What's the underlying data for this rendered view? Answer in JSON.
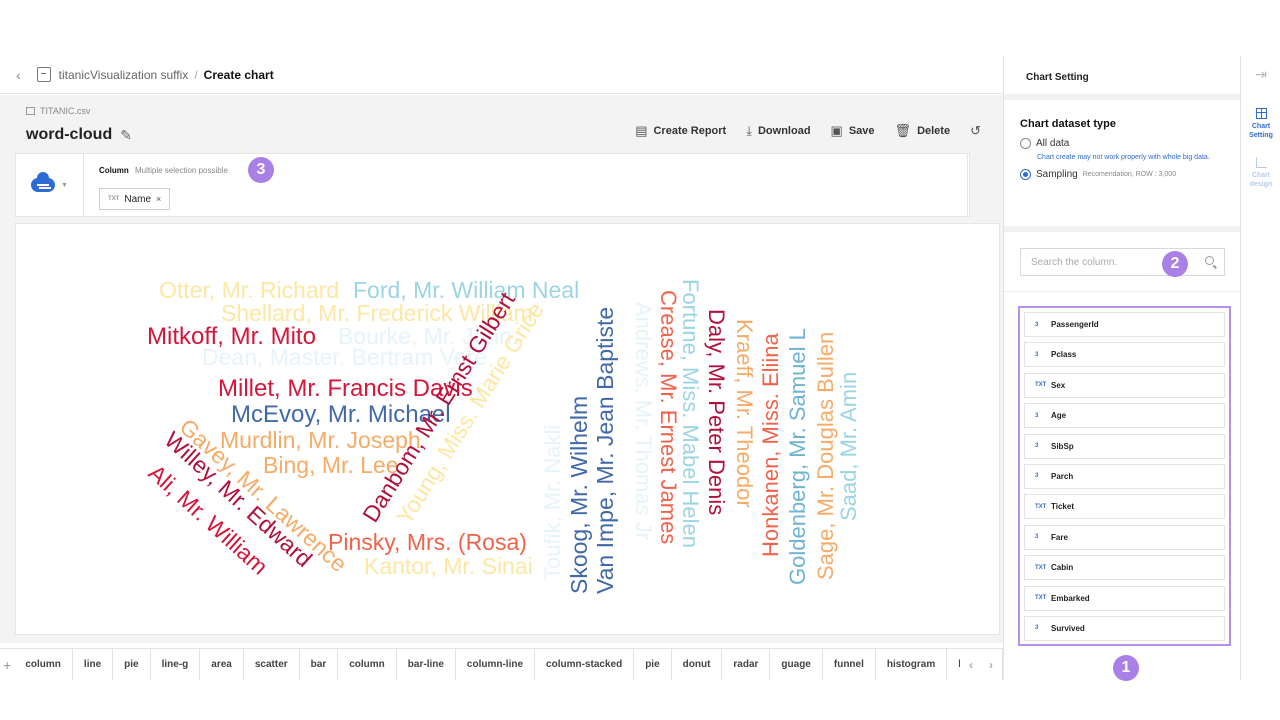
{
  "header": {
    "back_icon": "chevron-left-icon",
    "workbook_icon": "workbook-icon",
    "workbook": "titanicVisualization suffix",
    "separator": "/",
    "page": "Create chart"
  },
  "chart": {
    "dataset_file": "TITANIC.csv",
    "name": "word-cloud"
  },
  "toolbar": {
    "create_report": "Create Report",
    "download": "Download",
    "save": "Save",
    "delete": "Delete"
  },
  "column_panel": {
    "label": "Column",
    "hint": "Multiple selection possible",
    "selected_type": "TXT",
    "selected": "Name",
    "remove": "×"
  },
  "badges": {
    "one": "1",
    "two": "2",
    "three": "3"
  },
  "chart_data": {
    "type": "word-cloud",
    "words": [
      {
        "text": "Otter, Mr. Richard",
        "color": "#fde7a3"
      },
      {
        "text": "Ford, Mr. William Neal",
        "color": "#9bd5e3"
      },
      {
        "text": "Shellard, Mr. Frederick William",
        "color": "#fde7a3"
      },
      {
        "text": "Mitkoff, Mr. Mito",
        "color": "#d6153a"
      },
      {
        "text": "Bourke, Mr. John",
        "color": "#e6f3f8"
      },
      {
        "text": "Dean, Master. Bertram Vere",
        "color": "#e6f3f8"
      },
      {
        "text": "Millet, Mr. Francis Davis",
        "color": "#d6153a"
      },
      {
        "text": "McEvoy, Mr. Michael",
        "color": "#4169a8"
      },
      {
        "text": "Murdlin, Mr. Joseph",
        "color": "#f6ab66"
      },
      {
        "text": "Bing, Mr. Lee",
        "color": "#f6ab66"
      },
      {
        "text": "Pinsky, Mrs. (Rosa)",
        "color": "#f2624a"
      },
      {
        "text": "Kantor, Mr. Sinai",
        "color": "#fde7a3"
      },
      {
        "text": "Gavey, Mr. Lawrence",
        "color": "#f6ab66"
      },
      {
        "text": "Willey, Mr. Edward",
        "color": "#b0103b"
      },
      {
        "text": "Ali, Mr. William",
        "color": "#d6153a"
      },
      {
        "text": "Danbom, Mr. Ernst Gilbert",
        "color": "#b0103b"
      },
      {
        "text": "Young, Miss. Marie Grice",
        "color": "#fde7a3"
      },
      {
        "text": "Toufik, Mr. Nakli",
        "color": "#e6f3f8"
      },
      {
        "text": "Skoog, Mr. Wilhelm",
        "color": "#4169a8"
      },
      {
        "text": "Van Impe, Mr. Jean Baptiste",
        "color": "#4169a8"
      },
      {
        "text": "Andrews, Mr. Thomas Jr",
        "color": "#e6f3f8"
      },
      {
        "text": "Crease, Mr. Ernest James",
        "color": "#f2624a"
      },
      {
        "text": "Fortune, Miss. Mabel Helen",
        "color": "#9bd5e3"
      },
      {
        "text": "Daly, Mr. Peter Denis",
        "color": "#b0103b"
      },
      {
        "text": "Kraeff, Mr. Theodor",
        "color": "#f6ab66"
      },
      {
        "text": "Honkanen, Miss. Eliina",
        "color": "#f2624a"
      },
      {
        "text": "Goldenberg, Mr. Samuel L",
        "color": "#6fb3d2"
      },
      {
        "text": "Sage, Mr. Douglas Bullen",
        "color": "#f6ab66"
      },
      {
        "text": "Saad, Mr. Amin",
        "color": "#9bd5e3"
      }
    ]
  },
  "chart_types": [
    "column",
    "line",
    "pie",
    "line-g",
    "area",
    "scatter",
    "bar",
    "column",
    "bar-line",
    "column-line",
    "column-stacked",
    "pie",
    "donut",
    "radar",
    "guage",
    "funnel",
    "histogram",
    "boxplo"
  ],
  "typebar": {
    "add": "+",
    "prev": "‹",
    "next": "›"
  },
  "settings": {
    "title": "Chart Setting",
    "dataset_type_title": "Chart dataset type",
    "all_data": "All data",
    "warning": "Chart create may not work properly with whole big data.",
    "sampling": "Sampling",
    "sampling_note": "Recomendation, ROW : 3,000",
    "search_placeholder": "Search the column."
  },
  "columns": [
    {
      "type": "3",
      "name": "PassengerId"
    },
    {
      "type": "3",
      "name": "Pclass"
    },
    {
      "type": "TXT",
      "name": "Sex"
    },
    {
      "type": "3",
      "name": "Age"
    },
    {
      "type": "3",
      "name": "SibSp"
    },
    {
      "type": "3",
      "name": "Parch"
    },
    {
      "type": "TXT",
      "name": "Ticket"
    },
    {
      "type": "3",
      "name": "Fare"
    },
    {
      "type": "TXT",
      "name": "Cabin"
    },
    {
      "type": "TXT",
      "name": "Embarked"
    },
    {
      "type": "3",
      "name": "Survived"
    }
  ],
  "rail": {
    "collapse_icon": "collapse-right-icon",
    "setting": "Chart Setting",
    "design": "Chart design"
  },
  "colors": {
    "accent": "#2f6bd6",
    "highlight": "#b392ea",
    "badge": "#a980e6"
  }
}
